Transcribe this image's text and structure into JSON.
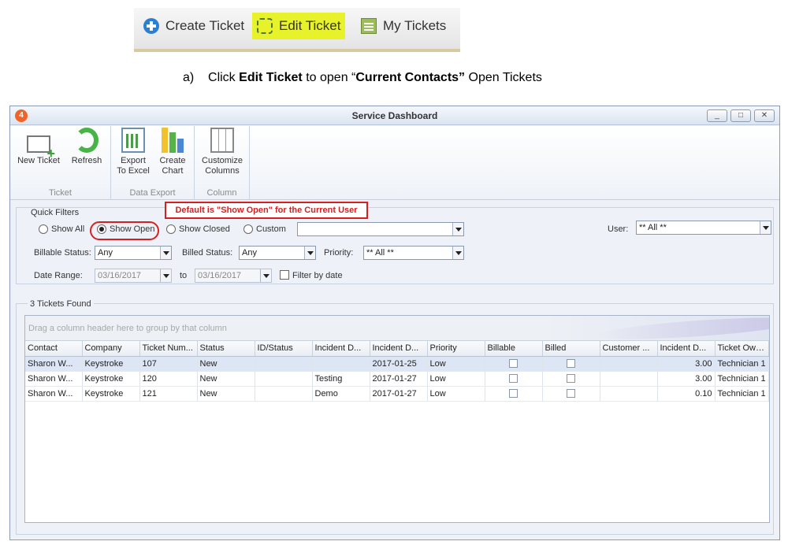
{
  "toolbar": {
    "create_ticket": "Create Ticket",
    "edit_ticket": "Edit Ticket",
    "my_tickets": "My Tickets"
  },
  "instruction": {
    "prefix": "a)",
    "click": "Click",
    "bold1": "Edit Ticket",
    "middle": "to open “",
    "bold2": "Current Contacts”",
    "suffix": "Open Tickets"
  },
  "window": {
    "title": "Service Dashboard",
    "icon_text": "4",
    "min": "_",
    "max": "□",
    "close": "✕"
  },
  "ribbon": {
    "groups": [
      {
        "label": "Ticket",
        "buttons": [
          "New Ticket",
          "Refresh"
        ]
      },
      {
        "label": "Data Export",
        "buttons": [
          "Export To Excel",
          "Create Chart"
        ]
      },
      {
        "label": "Column",
        "buttons": [
          "Customize Columns"
        ]
      }
    ],
    "new_ticket": "New Ticket",
    "refresh": "Refresh",
    "export_l1": "Export",
    "export_l2": "To Excel",
    "chart_l1": "Create",
    "chart_l2": "Chart",
    "cust_l1": "Customize",
    "cust_l2": "Columns",
    "group_ticket": "Ticket",
    "group_export": "Data Export",
    "group_column": "Column"
  },
  "filters": {
    "label": "Quick Filters",
    "callout": "Default is \"Show Open\" for the Current User",
    "show_all": "Show All",
    "show_open": "Show Open",
    "show_closed": "Show Closed",
    "custom": "Custom",
    "custom_value": "",
    "user_label": "User:",
    "user_value": "** All **",
    "billable_label": "Billable Status:",
    "billable_value": "Any",
    "billed_label": "Billed Status:",
    "billed_value": "Any",
    "priority_label": "Priority:",
    "priority_value": "** All **",
    "date_label": "Date Range:",
    "date_from": "03/16/2017",
    "date_to_label": "to",
    "date_to": "03/16/2017",
    "filter_by_date": "Filter by date"
  },
  "results": {
    "found": "3 Tickets Found",
    "group_hint": "Drag a column header here to group by that column",
    "columns": [
      "Contact",
      "Company",
      "Ticket Num...",
      "Status",
      "ID/Status",
      "Incident D...",
      "Incident D...",
      "Priority",
      "Billable",
      "Billed",
      "Customer ...",
      "Incident D...",
      "Ticket Owner"
    ],
    "rows": [
      {
        "contact": "Sharon W...",
        "company": "Keystroke",
        "ticket": "107",
        "status": "New",
        "idstatus": "",
        "inc1": "",
        "inc2": "2017-01-25",
        "priority": "Low",
        "incd": "3.00",
        "owner": "Technician 1"
      },
      {
        "contact": "Sharon W...",
        "company": "Keystroke",
        "ticket": "120",
        "status": "New",
        "idstatus": "",
        "inc1": "Testing",
        "inc2": "2017-01-27",
        "priority": "Low",
        "incd": "3.00",
        "owner": "Technician 1"
      },
      {
        "contact": "Sharon W...",
        "company": "Keystroke",
        "ticket": "121",
        "status": "New",
        "idstatus": "",
        "inc1": "Demo",
        "inc2": "2017-01-27",
        "priority": "Low",
        "incd": "0.10",
        "owner": "Technician 1"
      }
    ]
  },
  "colors": {
    "highlight": "#e8f22a",
    "annotation_red": "#d52020",
    "refresh_green": "#48b347"
  }
}
